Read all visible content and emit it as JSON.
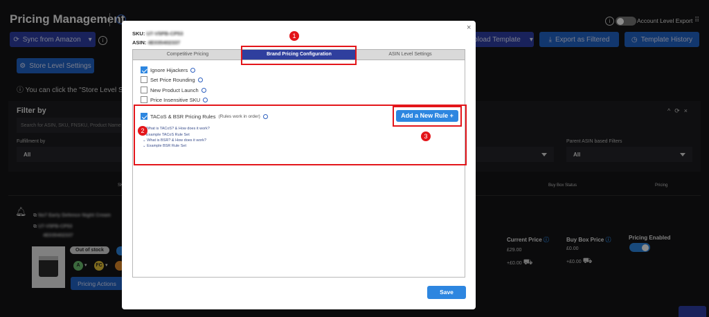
{
  "page": {
    "title": "Pricing Management",
    "account_level_export": "Account Level Export",
    "sync_button": "Sync from Amazon",
    "upload_template": "pload Template",
    "export_filtered": "Export as Filtered",
    "template_history": "Template History",
    "store_level_settings": "Store Level Settings",
    "hint_text": "You can click the \"Store Level Setting",
    "filter_by": "Filter by",
    "search_placeholder": "Search for ASIN, SKU, FNSKU, Product Name",
    "fulfillment_label": "Fulfillment by",
    "fulfillment_value": "All",
    "parent_asin_label": "Parent ASIN based Filters",
    "parent_asin_value": "All",
    "col_sku": "SK",
    "col_buybox_status": "Buy Box Status",
    "col_pricing": "Pricing",
    "product_name": "No7 Early Defence Night Cream",
    "product_sku": "U7-V5PB-CP53",
    "product_asin": "4E035402337",
    "out_of_stock": "Out of stock",
    "pricing_actions": "Pricing Actions",
    "current_price_label": "Current Price",
    "current_price_value": "£29.00",
    "current_shipping": "+£0.00",
    "buybox_price_label": "Buy Box Price",
    "buybox_price_value": "£0.00",
    "buybox_shipping": "+£0.00",
    "pricing_enabled_label": "Pricing Enabled",
    "chip_a": "A",
    "chip_fc": "FC"
  },
  "modal": {
    "sku_label": "SKU:",
    "sku_value": "U7-V5PB-CP53",
    "asin_label": "ASIN:",
    "asin_value": "4E035402337",
    "tabs": [
      "Competitive Pricing",
      "Brand Pricing Configuration",
      "ASIN Level Settings"
    ],
    "options": [
      {
        "label": "Ignore Hijackers",
        "checked": true
      },
      {
        "label": "Set Price Rounding",
        "checked": false
      },
      {
        "label": "New Product Launch",
        "checked": false
      },
      {
        "label": "Price Insensitive SKU",
        "checked": false
      }
    ],
    "tacos_label": "TACoS & BSR Pricing Rules",
    "tacos_note": "(Rules work in order)",
    "links": [
      "What is TACoS? & How does it work?",
      "Example TACoS Rule Set",
      "What is BSR? & How does it work?",
      "Example BSR Rule Set"
    ],
    "add_rule": "Add a New Rule +",
    "save": "Save",
    "close": "×"
  },
  "annotations": [
    "1",
    "2",
    "3"
  ],
  "colors": {
    "accent": "#2d86e0",
    "highlight": "#e3151a",
    "active_tab": "#2f3f9e"
  }
}
